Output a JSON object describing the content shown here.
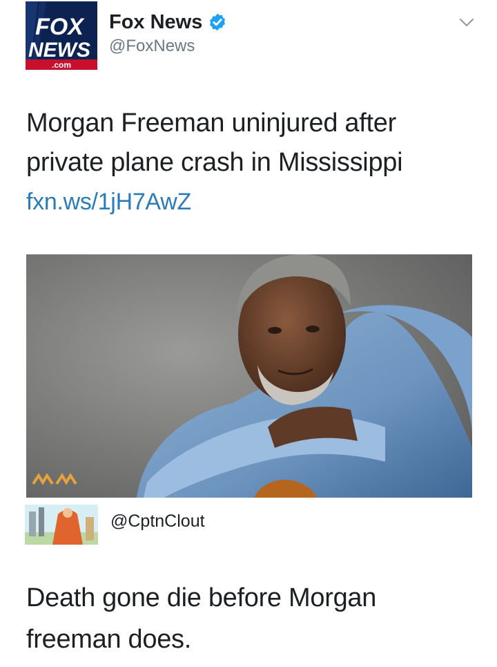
{
  "tweet": {
    "author_name": "Fox News",
    "author_handle": "@FoxNews",
    "text": "Morgan Freeman uninjured after private plane crash in Mississippi",
    "link": "fxn.ws/1jH7AwZ"
  },
  "avatar_logo": {
    "line1": "FOX",
    "line2": "NEWS",
    "line3": ".com"
  },
  "reply": {
    "handle": "@CptnClout",
    "text": "Death gone die before Morgan freeman does."
  },
  "icons": {
    "verified": "verified-badge-icon",
    "menu": "chevron-down-icon"
  },
  "colors": {
    "link": "#2b7bb9",
    "verified": "#1da1f2",
    "handle": "#697882",
    "fox_navy": "#0c2352",
    "fox_red": "#c8102e"
  }
}
